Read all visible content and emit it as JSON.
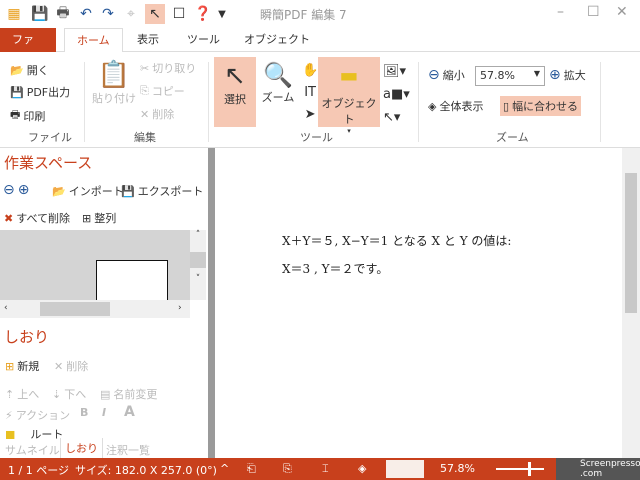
{
  "app": {
    "title": "瞬簡PDF 編集 7"
  },
  "tabs": [
    {
      "label": "ファイル"
    },
    {
      "label": "ホーム"
    },
    {
      "label": "表示"
    },
    {
      "label": "ツール"
    },
    {
      "label": "オブジェクト"
    }
  ],
  "ribbon": {
    "file": {
      "open": "開く",
      "pdf_out": "PDF出力",
      "print": "印刷",
      "group": "ファイル"
    },
    "edit": {
      "paste": "貼り付け",
      "cut": "切り取り",
      "copy": "コピー",
      "delete": "削除",
      "group": "編集"
    },
    "tools": {
      "select": "選択",
      "zoom": "ズーム",
      "object": "オブジェクト",
      "group": "ツール"
    },
    "zoom": {
      "shrink": "縮小",
      "value": "57.8%",
      "enlarge": "拡大",
      "fit_all": "全体表示",
      "fit_width": "幅に合わせる",
      "group": "ズーム"
    }
  },
  "workspace": {
    "title": "作業スペース",
    "import": "インポート",
    "export": "エクスポート",
    "delete_all": "すべて削除",
    "arrange": "整列"
  },
  "bookmarks": {
    "title": "しおり",
    "new": "新規",
    "delete": "削除",
    "up": "上へ",
    "down": "下へ",
    "rename": "名前変更",
    "action": "アクション",
    "bold": "B",
    "italic": "I",
    "font": "A",
    "root": "ルート"
  },
  "panel_tabs": [
    {
      "label": "サムネイル"
    },
    {
      "label": "しおり"
    },
    {
      "label": "注釈一覧"
    }
  ],
  "document": {
    "line1": "X＋Y＝５, X−Y＝1 となる X と Y の値は:",
    "line2": "X＝3 , Y＝２です。"
  },
  "status": {
    "page": "1 / 1 ページ",
    "size": "サイズ: 182.0 X 257.0 (0°)",
    "zoom": "57.8%",
    "watermark": "Screenpresso .com"
  },
  "colors": {
    "accent": "#c8401c",
    "highlight": "#f6c8b4"
  }
}
